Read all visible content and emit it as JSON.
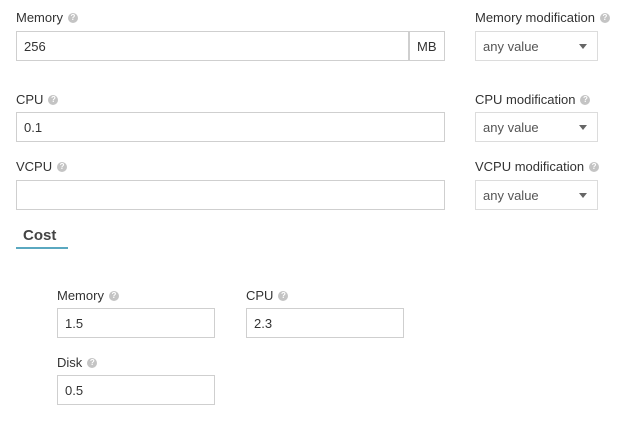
{
  "capacity": {
    "memory": {
      "label": "Memory",
      "value": "256",
      "unit": "MB"
    },
    "memory_modification": {
      "label": "Memory modification",
      "value": "any value"
    },
    "cpu": {
      "label": "CPU",
      "value": "0.1"
    },
    "cpu_modification": {
      "label": "CPU modification",
      "value": "any value"
    },
    "vcpu": {
      "label": "VCPU",
      "value": ""
    },
    "vcpu_modification": {
      "label": "VCPU modification",
      "value": "any value"
    }
  },
  "cost": {
    "tab_title": "Cost",
    "memory": {
      "label": "Memory",
      "value": "1.5"
    },
    "cpu": {
      "label": "CPU",
      "value": "2.3"
    },
    "disk": {
      "label": "Disk",
      "value": "0.5"
    }
  },
  "icons": {
    "help": "help-question-icon",
    "dropdown": "caret-down-icon"
  },
  "colors": {
    "tab_underline": "#5aa8c0",
    "border": "#cfcfcf"
  }
}
